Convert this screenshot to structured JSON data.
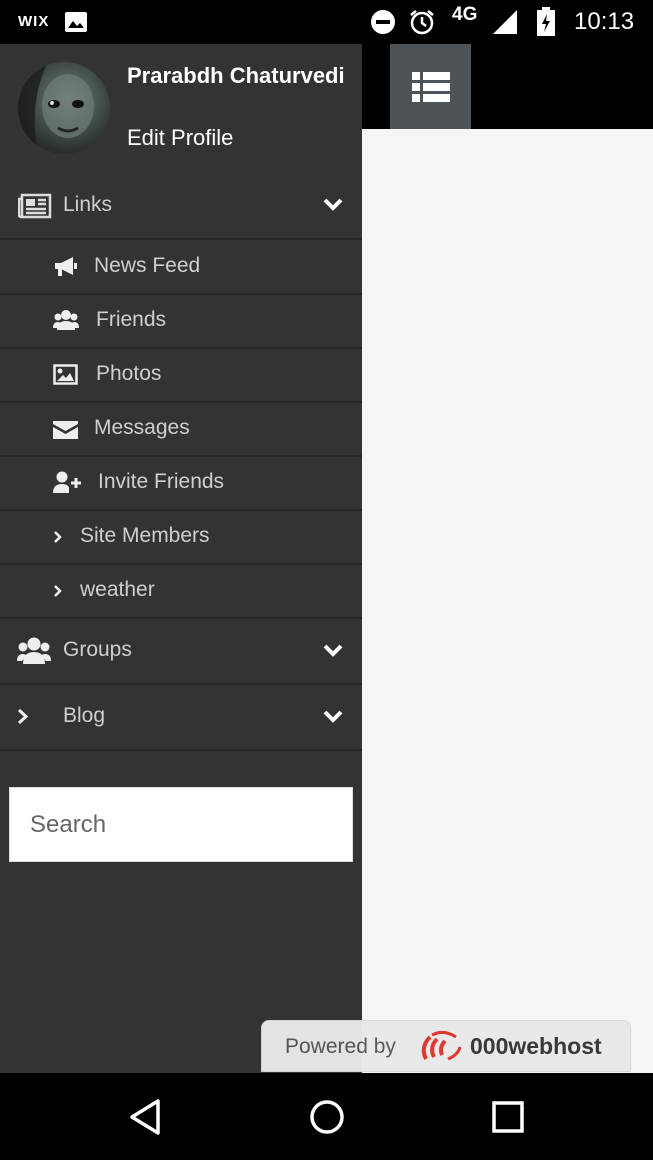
{
  "status_bar": {
    "carrier_logo": "WIX",
    "network": "4G",
    "time": "10:13",
    "icons": [
      "image-icon",
      "do-not-disturb-icon",
      "alarm-icon",
      "signal-icon",
      "battery-charging-icon"
    ]
  },
  "profile": {
    "name": "Prarabdh Chaturvedi",
    "edit_label": "Edit Profile"
  },
  "menu": {
    "links": {
      "label": "Links",
      "icon": "newspaper-icon"
    },
    "sub_items": [
      {
        "label": "News Feed",
        "icon": "megaphone-icon"
      },
      {
        "label": "Friends",
        "icon": "users-icon"
      },
      {
        "label": "Photos",
        "icon": "picture-icon"
      },
      {
        "label": "Messages",
        "icon": "envelope-icon"
      },
      {
        "label": "Invite Friends",
        "icon": "user-plus-icon"
      },
      {
        "label": "Site Members",
        "icon": "chevron-right-icon"
      },
      {
        "label": "weather",
        "icon": "chevron-right-icon"
      }
    ],
    "groups": {
      "label": "Groups",
      "icon": "users-icon"
    },
    "blog": {
      "label": "Blog",
      "icon": "chevron-right-icon"
    }
  },
  "search": {
    "placeholder": "Search"
  },
  "footer_badge": {
    "prefix": "Powered by",
    "brand": "000webhost"
  },
  "colors": {
    "drawer_bg": "#333333",
    "divider": "#262626",
    "toggle_bg": "#4d5356",
    "content_bg": "#f5f5f5",
    "brand_red": "#e0322b"
  }
}
